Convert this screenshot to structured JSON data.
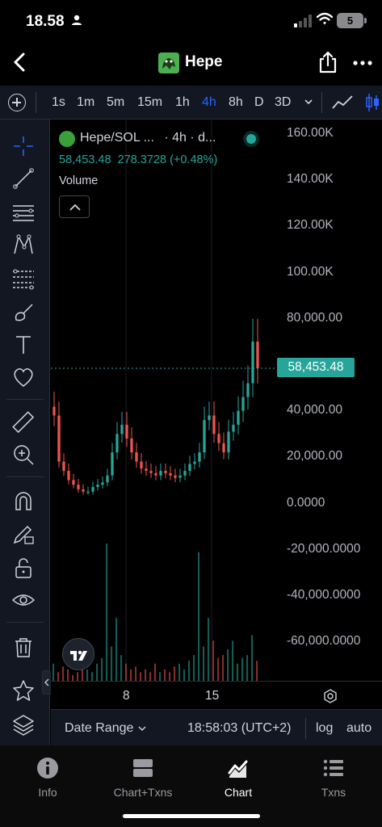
{
  "status_bar": {
    "time": "18.58",
    "battery": "5"
  },
  "nav": {
    "title": "Hepe",
    "back_icon": "chevron-left-icon",
    "share_icon": "share-icon",
    "more_icon": "ellipsis-icon"
  },
  "toolbar": {
    "intervals": [
      "1s",
      "1m",
      "5m",
      "15m",
      "1h",
      "4h",
      "8h",
      "D",
      "3D"
    ],
    "active_interval": "4h",
    "accent": "#2962ff"
  },
  "drawing_tools": [
    "crosshair-icon",
    "trend-line-icon",
    "horizontal-lines-icon",
    "pattern-icon",
    "fib-retracement-icon",
    "brush-icon",
    "text-icon",
    "heart-icon",
    "ruler-icon",
    "zoom-in-icon",
    "magnet-icon",
    "lock-pencil-icon",
    "unlock-icon",
    "eye-icon",
    "trash-icon",
    "star-icon",
    "layers-icon"
  ],
  "legend": {
    "pair": "Hepe/SOL ...",
    "timeframe": "· 4h · d...",
    "values": "58,453.48  278.3728 (+0.48%)",
    "volume_label": "Volume"
  },
  "price_tag": "58,453.48",
  "y_axis_labels": [
    "160.00K",
    "140.00K",
    "120.00K",
    "100.00K",
    "80,000.00",
    "40,000.00",
    "20,000.00",
    "0.0000",
    "-20,000.0000",
    "-40,000.0000",
    "-60,000.0000"
  ],
  "x_axis_labels": [
    "8",
    "15"
  ],
  "bottom_bar": {
    "date_range": "Date Range",
    "clock": "18:58:03 (UTC+2)",
    "log": "log",
    "auto": "auto"
  },
  "tabs": [
    {
      "label": "Info",
      "icon": "info-icon"
    },
    {
      "label": "Chart+Txns",
      "icon": "split-view-icon"
    },
    {
      "label": "Chart",
      "icon": "chart-icon"
    },
    {
      "label": "Txns",
      "icon": "list-icon"
    }
  ],
  "active_tab": "Chart",
  "colors": {
    "up": "#26a69a",
    "down": "#ef5350",
    "panel": "#131722"
  },
  "chart_data": {
    "type": "candlestick",
    "series_values": [
      38000,
      18000,
      14000,
      10000,
      8000,
      6000,
      5000,
      5000,
      7000,
      8000,
      9000,
      12000,
      22000,
      30000,
      34000,
      28000,
      22000,
      18000,
      15000,
      14000,
      13000,
      12000,
      14000,
      13000,
      12000,
      11000,
      12000,
      14000,
      17000,
      18000,
      22000,
      36000,
      38000,
      30000,
      26000,
      22000,
      31000,
      34000,
      40000,
      46000,
      52000,
      70000,
      58453
    ],
    "volume_values": [
      6000,
      3000,
      5000,
      4000,
      2000,
      3000,
      5000,
      4000,
      3000,
      6000,
      8000,
      48000,
      12000,
      22000,
      9000,
      6000,
      4000,
      5000,
      3000,
      4000,
      3000,
      6000,
      3000,
      4000,
      3000,
      5000,
      6000,
      4000,
      7000,
      9000,
      45000,
      12000,
      22000,
      14000,
      8000,
      9000,
      11000,
      14000,
      6000,
      8000,
      9000,
      16000,
      7000
    ],
    "ylim": [
      -75000,
      165000
    ],
    "last_price": 58453.48
  }
}
